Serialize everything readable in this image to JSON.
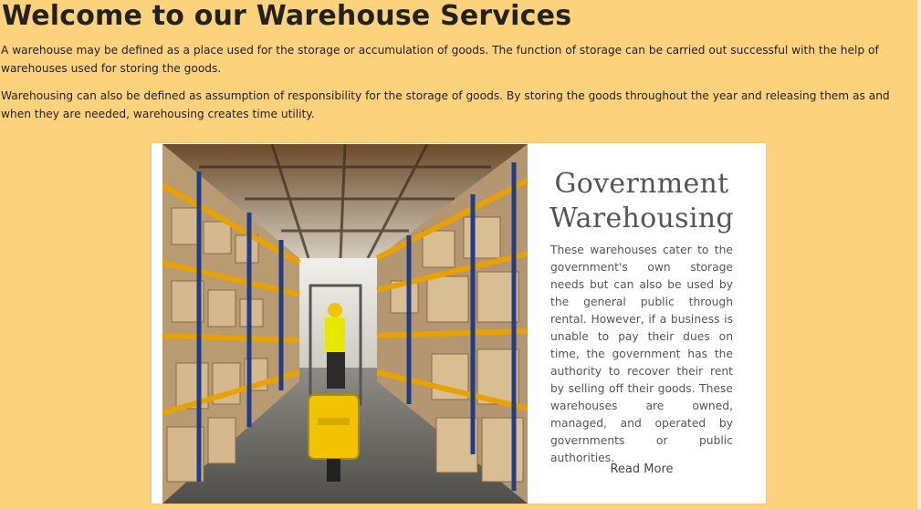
{
  "page": {
    "title": "Welcome to our Warehouse Services",
    "paragraphs": [
      "A warehouse may be defined as a place used for the storage or accumulation of goods. The function of storage can be carried out successful with the help of warehouses used for storing the goods.",
      "Warehousing can also be defined as assumption of responsibility for the storage of goods. By storing the goods throughout the year and releasing them as and when they are needed, warehousing creates time utility."
    ]
  },
  "card": {
    "title": "Government Warehousing",
    "body": "These warehouses cater to the government's own storage needs but can also be used by the general public through rental. However, if a business is unable to pay their dues on time, the government has the authority to recover their rent by selling off their goods. These warehouses are owned, managed, and operated by governments or public authorities.",
    "read_more_label": "Read More"
  },
  "colors": {
    "background": "#fdd27d",
    "card_background": "#ffffff",
    "forklift_yellow": "#f2c300",
    "shelf_orange": "#e8a200",
    "shelf_blue": "#1f3d8a"
  }
}
